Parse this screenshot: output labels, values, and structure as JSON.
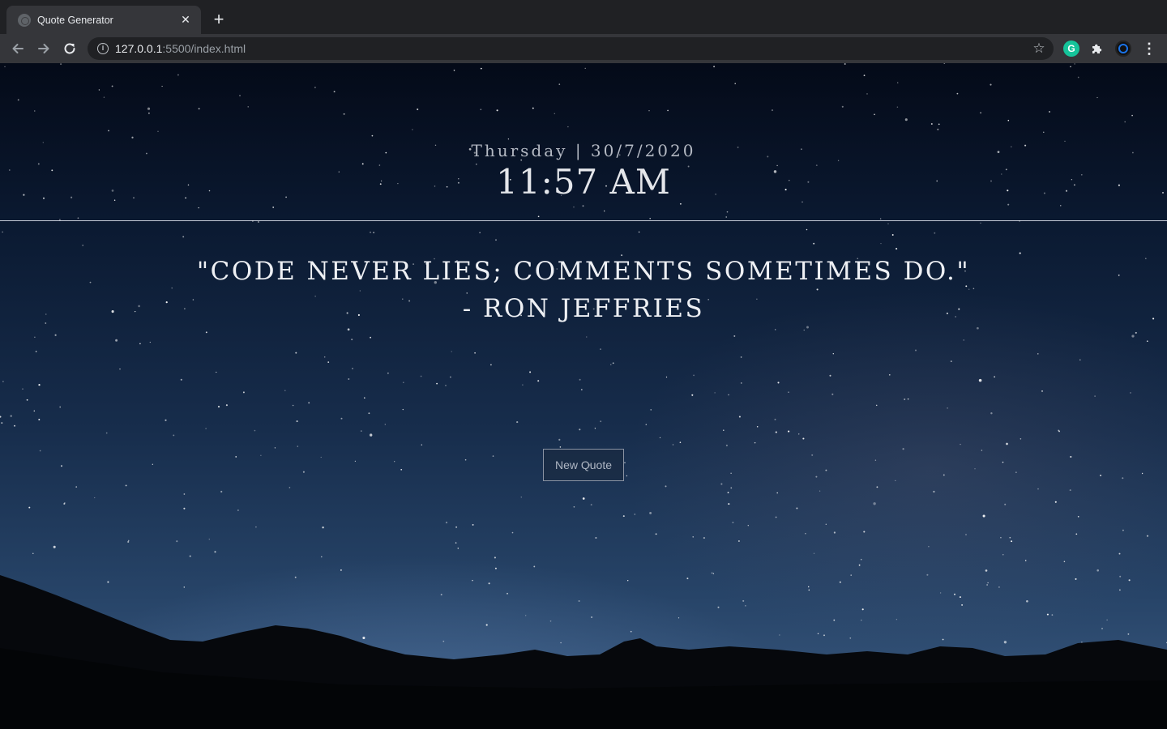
{
  "browser": {
    "tab_title": "Quote Generator",
    "tab_close_glyph": "✕",
    "new_tab_glyph": "+",
    "url_host": "127.0.0.1",
    "url_rest": ":5500/index.html",
    "icons": [
      "back-arrow-icon",
      "forward-arrow-icon",
      "reload-icon",
      "info-icon",
      "star-icon",
      "grammarly-icon",
      "puzzle-extension-icon",
      "profile-avatar-icon",
      "kebab-menu-icon"
    ]
  },
  "page": {
    "date_text": "Thursday | 30/7/2020",
    "time_text": "11:57 AM",
    "quote_text": "\"Code never lies; comments sometimes do.\"",
    "author_text": "- Ron Jeffries",
    "button_label": "New Quote"
  },
  "colors": {
    "sky_top": "#040a18",
    "sky_bottom": "#3b5a80",
    "text": "#eef0f4",
    "button_border": "#8a93a3"
  }
}
